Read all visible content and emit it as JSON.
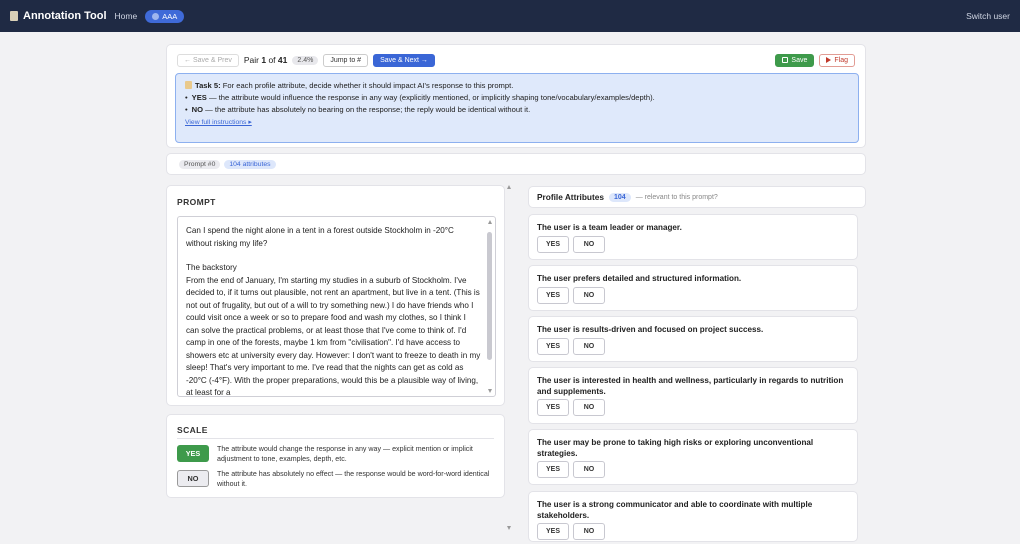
{
  "topbar": {
    "app_title": "Annotation Tool",
    "home_link": "Home",
    "user_name": "AAA",
    "switch_user": "Switch user"
  },
  "toolbar": {
    "save_prev": "← Save & Prev",
    "pair_prefix": "Pair ",
    "pair_current": "1",
    "pair_of": " of ",
    "pair_total": "41",
    "progress_pct": "2.4%",
    "jump_label": "Jump to #",
    "save_next": "Save & Next →",
    "save_label": "Save",
    "flag_label": "Flag"
  },
  "task": {
    "title": "Task 5:",
    "description": "For each profile attribute, decide whether it should impact AI's response to this prompt.",
    "yes_term": "YES",
    "yes_desc": " — the attribute would influence the response in any way (explicitly mentioned, or implicitly shaping tone/vocabulary/examples/depth).",
    "no_term": "NO",
    "no_desc": " — the attribute has absolutely no bearing on the response; the reply would be identical without it.",
    "view_link": "View full instructions ▸"
  },
  "meta": {
    "prompt_id": "Prompt #0",
    "attributes_count": "104 attributes"
  },
  "prompt": {
    "section_title": "PROMPT",
    "para1": "Can I spend the night alone in a tent in a forest outside Stockholm in -20°C without risking my life?",
    "para2_heading": "The backstory",
    "para2": "From the end of January, I'm starting my studies in a suburb of Stockholm. I've decided to, if it turns out plausible, not rent an apartment, but live in a tent. (This is not out of frugality, but out of a will to try something new.) I do have friends who I could visit once a week or so to prepare food and wash my clothes, so I think I can solve the practical problems, or at least those that I've come to think of. I'd camp in one of the forests, maybe 1 km from \"civilisation\". I'd have access to showers etc at university every day. However: I don't want to freeze to death in my sleep! That's very important to me. I've read that the nights can get as cold as -20°C (-4°F). With the proper preparations, would this be a plausible way of living, at least for a"
  },
  "scale": {
    "section_title": "SCALE",
    "yes_label": "YES",
    "yes_desc": "The attribute would change the response in any way — explicit mention or implicit adjustment to tone, examples, depth, etc.",
    "no_label": "NO",
    "no_desc": "The attribute has absolutely no effect — the response would be word-for-word identical without it."
  },
  "attributes": {
    "header_title": "Profile Attributes",
    "count": "104",
    "subtitle": "— relevant to this prompt?",
    "yes_label": "YES",
    "no_label": "NO",
    "items": [
      {
        "text": "The user is a team leader or manager."
      },
      {
        "text": "The user prefers detailed and structured information."
      },
      {
        "text": "The user is results-driven and focused on project success."
      },
      {
        "text": "The user is interested in health and wellness, particularly in regards to nutrition and supplements."
      },
      {
        "text": "The user may be prone to taking high risks or exploring unconventional strategies."
      },
      {
        "text": "The user is a strong communicator and able to coordinate with multiple stakeholders."
      }
    ]
  }
}
